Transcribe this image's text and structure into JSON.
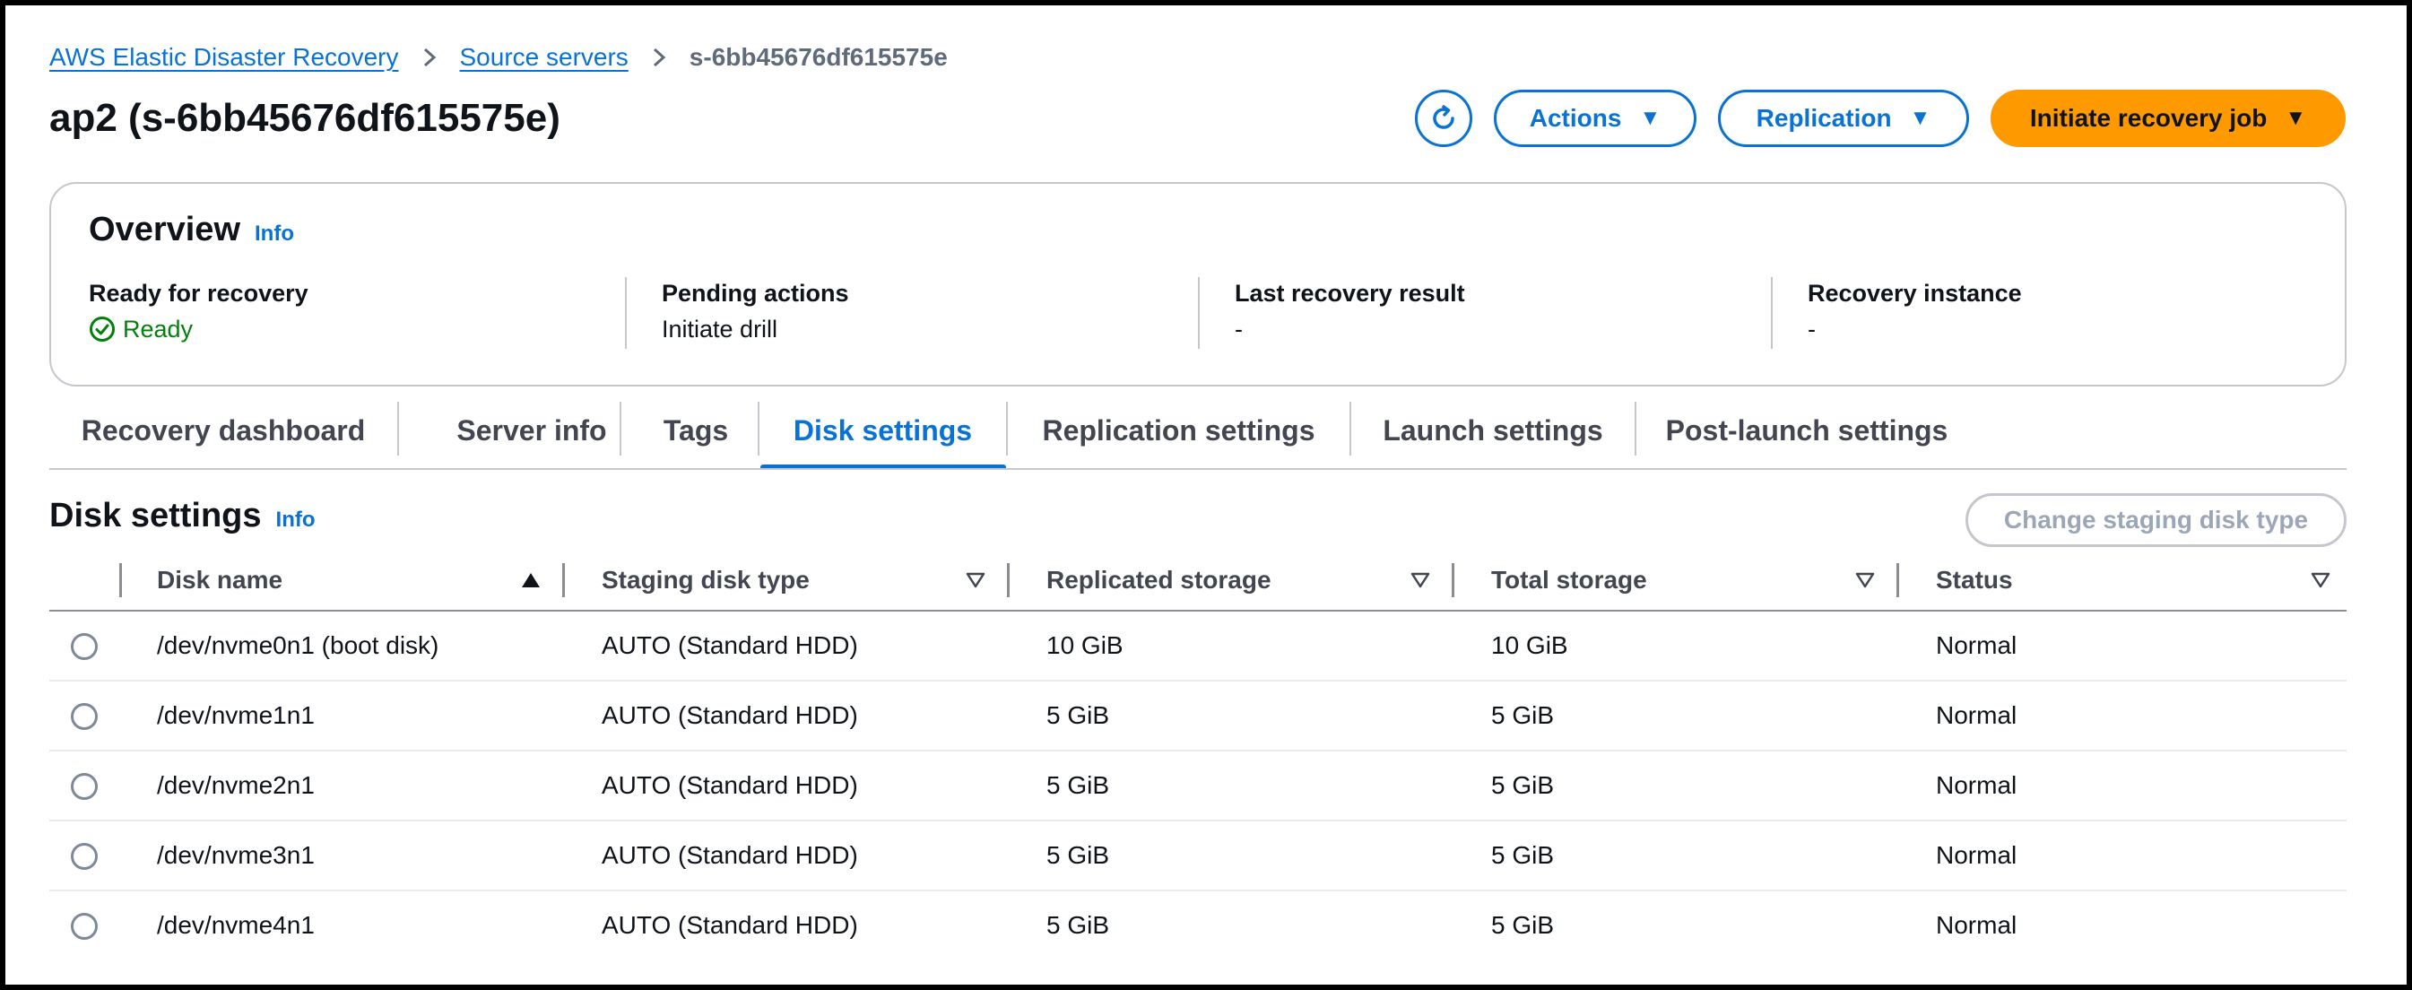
{
  "breadcrumb": {
    "items": [
      "AWS Elastic Disaster Recovery",
      "Source servers"
    ],
    "current": "s-6bb45676df615575e",
    "separator_icon": "chevron-right-icon"
  },
  "page": {
    "title": "ap2 (s-6bb45676df615575e)"
  },
  "header_actions": {
    "refresh_icon": "refresh-icon",
    "actions_label": "Actions",
    "replication_label": "Replication",
    "initiate_label": "Initiate recovery job",
    "caret": "▼"
  },
  "overview": {
    "title": "Overview",
    "info": "Info",
    "columns": [
      {
        "label": "Ready for recovery",
        "value": "Ready",
        "status_icon": "check-circle-icon",
        "status_color": "#037f0c"
      },
      {
        "label": "Pending actions",
        "value": "Initiate drill"
      },
      {
        "label": "Last recovery result",
        "value": "-"
      },
      {
        "label": "Recovery instance",
        "value": "-"
      }
    ]
  },
  "tabs": {
    "items": [
      "Recovery dashboard",
      "Server info",
      "Tags",
      "Disk settings",
      "Replication settings",
      "Launch settings",
      "Post-launch settings"
    ],
    "active": "Disk settings"
  },
  "disk_settings": {
    "title": "Disk settings",
    "info": "Info",
    "change_button": "Change staging disk type",
    "columns": [
      "Disk name",
      "Staging disk type",
      "Replicated storage",
      "Total storage",
      "Status"
    ],
    "sorted_column": "Disk name",
    "rows": [
      {
        "name": "/dev/nvme0n1 (boot disk)",
        "type": "AUTO (Standard HDD)",
        "replicated": "10 GiB",
        "total": "10 GiB",
        "status": "Normal"
      },
      {
        "name": "/dev/nvme1n1",
        "type": "AUTO (Standard HDD)",
        "replicated": "5 GiB",
        "total": "5 GiB",
        "status": "Normal"
      },
      {
        "name": "/dev/nvme2n1",
        "type": "AUTO (Standard HDD)",
        "replicated": "5 GiB",
        "total": "5 GiB",
        "status": "Normal"
      },
      {
        "name": "/dev/nvme3n1",
        "type": "AUTO (Standard HDD)",
        "replicated": "5 GiB",
        "total": "5 GiB",
        "status": "Normal"
      },
      {
        "name": "/dev/nvme4n1",
        "type": "AUTO (Standard HDD)",
        "replicated": "5 GiB",
        "total": "5 GiB",
        "status": "Normal"
      }
    ]
  },
  "colors": {
    "link": "#0972d3",
    "primary_button": "#ff9900",
    "success": "#037f0c",
    "text": "#0f141a",
    "muted": "#5f6b7a"
  }
}
